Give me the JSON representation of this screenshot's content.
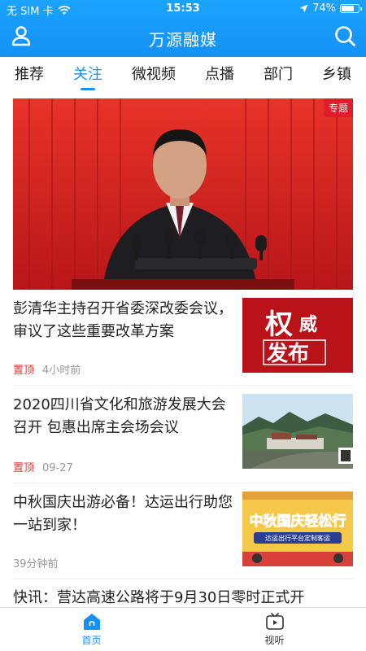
{
  "status": {
    "carrier": "无 SIM 卡",
    "time": "15:53",
    "battery_text": "74%",
    "battery_level": 0.74
  },
  "header": {
    "title": "万源融媒"
  },
  "tabs": [
    {
      "label": "推荐"
    },
    {
      "label": "关注"
    },
    {
      "label": "微视频"
    },
    {
      "label": "点播"
    },
    {
      "label": "部门"
    },
    {
      "label": "乡镇"
    }
  ],
  "active_tab_index": 1,
  "hero": {
    "badge": "专题"
  },
  "news": [
    {
      "title": "彭清华主持召开省委深改委会议，审议了这些重要改革方案",
      "pin": "置顶",
      "time": "4小时前",
      "thumb_text": {
        "a": "权",
        "b": "威",
        "c": "发布"
      }
    },
    {
      "title": "2020四川省文化和旅游发展大会召开 包惠出席主会场会议",
      "pin": "置顶",
      "time": "09-27"
    },
    {
      "title": "中秋国庆出游必备！达运出行助您一站到家！",
      "time": "39分钟前",
      "thumb_text": {
        "main": "中秋国庆轻松行",
        "sub": "达运出行平台定制客运"
      }
    }
  ],
  "partial_news_title": "快讯：营达高速公路将于9月30日零时正式开",
  "bottom_nav": [
    {
      "label": "首页"
    },
    {
      "label": "视听"
    }
  ],
  "colors": {
    "brand": "#1592f5",
    "pin_red": "#e53935",
    "badge_red": "#e11d2b"
  }
}
